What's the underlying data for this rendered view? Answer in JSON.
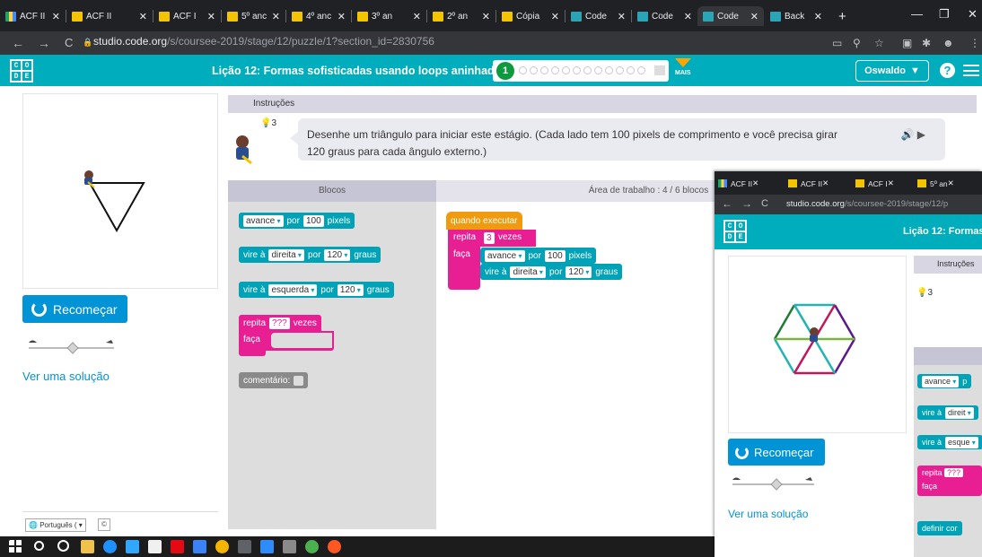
{
  "browser": {
    "tabs": [
      {
        "label": "ACF II",
        "fav": "#f5c400"
      },
      {
        "label": "ACF II",
        "fav": "#f5c400"
      },
      {
        "label": "ACF I",
        "fav": "#f5c400"
      },
      {
        "label": "5º anc",
        "fav": "#f5c400"
      },
      {
        "label": "4º anc",
        "fav": "#f5c400"
      },
      {
        "label": "3º an",
        "fav": "#f5c400"
      },
      {
        "label": "2º an",
        "fav": "#f5c400"
      },
      {
        "label": "Cópia",
        "fav": "#f5c400"
      },
      {
        "label": "Code",
        "fav": "#2aa5b5"
      },
      {
        "label": "Code",
        "fav": "#2aa5b5"
      },
      {
        "label": "Code",
        "fav": "#2aa5b5"
      },
      {
        "label": "Back",
        "fav": "#2aa5b5"
      }
    ],
    "new_tab": "+",
    "url_domain": "studio.code.org",
    "url_path": "/s/coursee-2019/stage/12/puzzle/1?section_id=2830756"
  },
  "header": {
    "logo_letters": [
      "C",
      "O",
      "D",
      "E"
    ],
    "lesson_title": "Lição 12: Formas sofisticadas usando loops aninhados",
    "current_level": "1",
    "more_label": "MAIS",
    "user_name": "Oswaldo",
    "help": "?"
  },
  "left": {
    "reset_label": "Recomeçar",
    "solution_link": "Ver uma solução",
    "language": "Português ( ",
    "copyright": "©"
  },
  "instructions": {
    "tab": "Instruções",
    "text": "Desenhe um triângulo para iniciar este estágio. (Cada lado tem 100 pixels de comprimento e você precisa girar 120 graus para cada ângulo externo.)",
    "hint_count": "3"
  },
  "workspace": {
    "toolbox_title": "Blocos",
    "workspace_title": "Área de trabalho : 4 / 6 blocos"
  },
  "toolbox_blocks": {
    "forward": {
      "action": "avance",
      "by": "por",
      "value": "100",
      "unit": "pixels"
    },
    "turn_right": {
      "action": "vire à",
      "dir": "direita",
      "by": "por",
      "value": "120",
      "unit": "graus"
    },
    "turn_left": {
      "action": "vire à",
      "dir": "esquerda",
      "by": "por",
      "value": "120",
      "unit": "graus"
    },
    "repeat": {
      "label": "repita",
      "value": "???",
      "unit": "vezes",
      "do": "faça"
    },
    "comment": {
      "label": "comentário:"
    }
  },
  "program": {
    "when_run": "quando executar",
    "repeat_label": "repita",
    "repeat_value": "3",
    "repeat_unit": "vezes",
    "do_label": "faça",
    "forward": {
      "action": "avance",
      "by": "por",
      "value": "100",
      "unit": "pixels"
    },
    "turn": {
      "action": "vire à",
      "dir": "direita",
      "by": "por",
      "value": "120",
      "unit": "graus"
    }
  },
  "second_window": {
    "tabs": [
      "ACF II",
      "ACF II",
      "ACF I",
      "5º an"
    ],
    "url_domain": "studio.code.org",
    "url_path": "/s/coursee-2019/stage/12/p",
    "lesson_title": "Lição 12: Formas",
    "instructions_tab": "Instruções",
    "hint_count": "3",
    "reset_label": "Recomeçar",
    "solution_link": "Ver uma solução",
    "blocks": [
      {
        "text": "avance",
        "sub": "p",
        "color": "#00a2b7"
      },
      {
        "text": "vire à",
        "sub": "direit",
        "color": "#00a2b7"
      },
      {
        "text": "vire à",
        "sub": "esque",
        "color": "#00a2b7"
      },
      {
        "text": "repita",
        "sub": "???",
        "color": "#e81f93"
      },
      {
        "text": "faça",
        "sub": "",
        "color": "#e81f93"
      },
      {
        "text": "definir cor",
        "sub": "",
        "color": "#00a2b7"
      }
    ]
  },
  "colors": {
    "accent": "#00adbc",
    "blue": "#0093d6",
    "teal_block": "#00a2b7",
    "pink_block": "#e81f93",
    "orange_block": "#ef9a0f",
    "level_green": "#0d9a3e",
    "background": "#f5a623"
  }
}
